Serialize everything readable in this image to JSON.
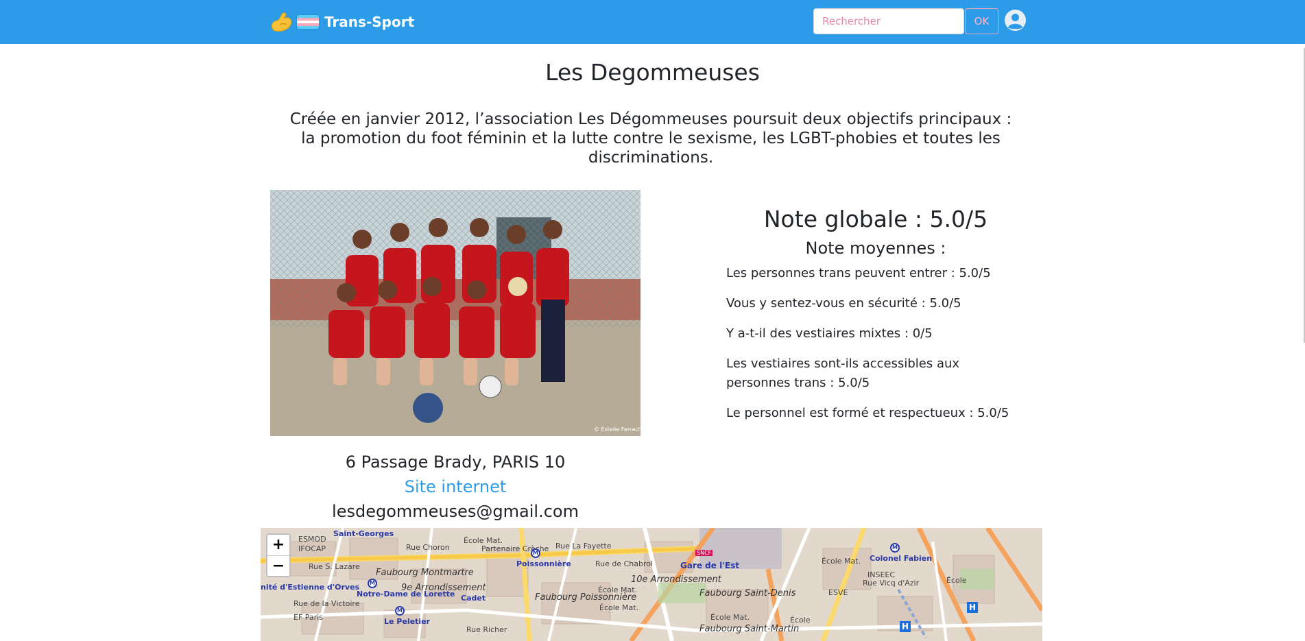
{
  "navbar": {
    "brand_name": "Trans-Sport",
    "brand_icons": [
      "flexed-biceps-emoji",
      "transgender-flag-emoji"
    ],
    "search_placeholder": "Rechercher",
    "search_button_label": "OK",
    "account_icon": "user-circle-icon",
    "colors": {
      "background": "#2d9ce8",
      "search_accent": "#e887ac"
    }
  },
  "place": {
    "title": "Les Degommeuses",
    "description": "Créée en janvier 2012, l’association Les Dégommeuses poursuit deux objectifs principaux : la promotion du foot féminin et la lutte contre le sexisme, les LGBT-phobies et toutes les discriminations.",
    "photo_credit": "© Estelle Ferrach",
    "address": "6 Passage Brady, PARIS 10",
    "website_label": "Site internet",
    "email": "lesdegommeuses@gmail.com"
  },
  "ratings": {
    "overall_label": "Note globale : 5.0/5",
    "averages_title": "Note moyennes :",
    "items": [
      {
        "text": "Les personnes trans peuvent entrer : 5.0/5",
        "value": 5.0
      },
      {
        "text": "Vous y sentez-vous en sécurité : 5.0/5",
        "value": 5.0
      },
      {
        "text": "Y a-t-il des vestiaires mixtes : 0/5",
        "value": 0
      },
      {
        "text": "Les vestiaires sont-ils accessibles aux personnes trans : 5.0/5",
        "value": 5.0
      },
      {
        "text": "Le personnel est formé et respectueux : 5.0/5",
        "value": 5.0
      }
    ]
  },
  "map": {
    "zoom_in_label": "+",
    "zoom_out_label": "−",
    "labels": {
      "esmod": "ESMOD",
      "ifocap": "IFOCAP",
      "saint_georges": "Saint-Georges",
      "rue_choron": "Rue Choron",
      "ecole_mat_1": "École Mat.",
      "partenaire_creche": "Partenaire Crèche",
      "poissonniere": "Poissonnière",
      "rue_la_fayette": "Rue La Fayette",
      "rue_chabrol": "Rue de Chabrol",
      "gare_de_l_est": "Gare de l'Est",
      "sncf": "SNCF",
      "colonel_fabien": "Colonel Fabien",
      "rue_st_lazare": "Rue S. Lazare",
      "faubourg_montmartre": "Faubourg Montmartre",
      "dixieme": "10e Arrondissement",
      "ecole_mat_2": "École Mat.",
      "inseec": "INSEEC",
      "rue_vicq": "Rue Vicq d'Azir",
      "ecole_mat_3": "École Mat.",
      "ecole": "École",
      "estienne": "nité d'Estienne d'Orves",
      "notre_dame": "Notre-Dame de Lorette",
      "neuvieme": "9e Arrondissement",
      "cadet": "Cadet",
      "faubourg_poissonniere": "Faubourg Poissonnière",
      "faubourg_saint_denis": "Faubourg Saint-Denis",
      "esve": "ESVE",
      "rue_victoire": "Rue de la Victoire",
      "ecole_mat_4": "École Mat.",
      "ecole_mat_5": "École Mat.",
      "ecole_2": "École",
      "ef_paris": "EF Paris",
      "le_peletier": "Le Peletier",
      "rue_richer": "Rue Richer",
      "faubourg_saint_martin": "Faubourg Saint-Martin",
      "metro_marker": "M",
      "hospital_marker": "H"
    }
  }
}
